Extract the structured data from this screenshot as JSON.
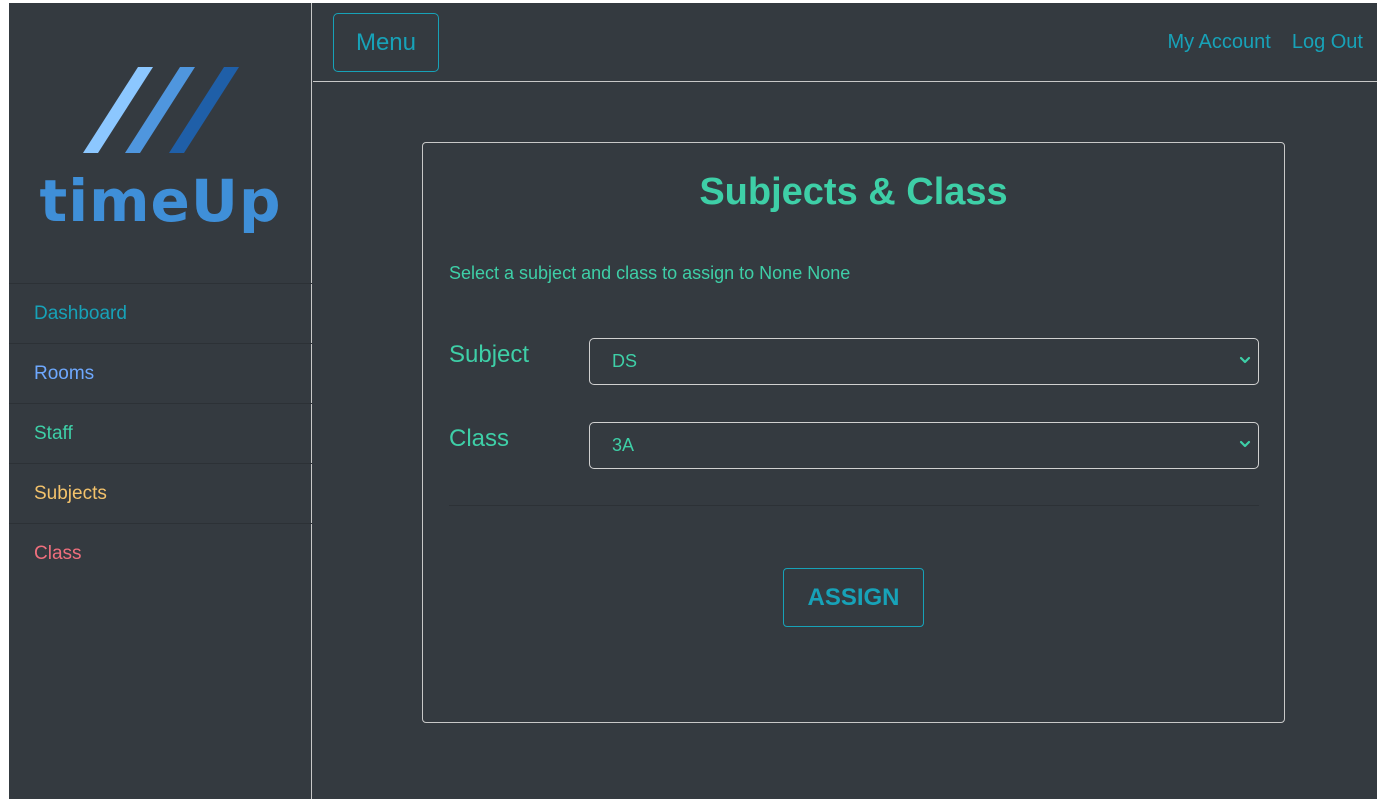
{
  "app": {
    "name": "timeUp"
  },
  "sidebar": {
    "items": [
      {
        "label": "Dashboard",
        "color": "#17a2b8"
      },
      {
        "label": "Rooms",
        "color": "#6ea8fe"
      },
      {
        "label": "Staff",
        "color": "#3ecfa7"
      },
      {
        "label": "Subjects",
        "color": "#f3c26b"
      },
      {
        "label": "Class",
        "color": "#ef6f7d"
      }
    ]
  },
  "header": {
    "menu_label": "Menu",
    "links": [
      "My Account",
      "Log Out"
    ]
  },
  "card": {
    "title": "Subjects & Class",
    "description": "Select a subject and class to assign to None None",
    "subject_label": "Subject",
    "subject_value": "DS",
    "class_label": "Class",
    "class_value": "3A",
    "assign_label": "ASSIGN"
  },
  "colors": {
    "background": "#343a40",
    "accent": "#17a2b8",
    "text_green": "#3ecfa7",
    "logo_blue": "#3f8fd8"
  },
  "icons": [
    "logo-stripes-icon",
    "chevron-down-icon"
  ]
}
